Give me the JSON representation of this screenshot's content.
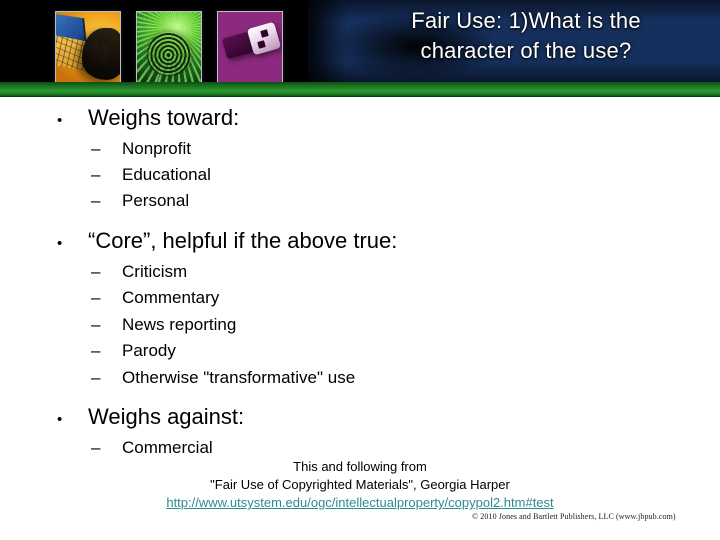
{
  "slide": {
    "title_line1": "Fair Use:  1)What is the",
    "title_line2": "character of the use?",
    "title_full": "Fair Use:  1)What is the\ncharacter of the use?"
  },
  "header": {
    "thumbnails": [
      {
        "name": "laptop-keyboard-hand-thumbnail",
        "alt": "Hand typing on a laptop keyboard"
      },
      {
        "name": "fingerprint-thumbnail",
        "alt": "Green fingerprint"
      },
      {
        "name": "usb-flash-drive-thumbnail",
        "alt": "Magenta USB flash drive"
      }
    ]
  },
  "bullets": [
    {
      "label": "Weighs toward:",
      "marker": "•",
      "children": [
        {
          "marker": "–",
          "label": "Nonprofit"
        },
        {
          "marker": "–",
          "label": "Educational"
        },
        {
          "marker": "–",
          "label": "Personal"
        }
      ]
    },
    {
      "label": "“Core”, helpful if the above true:",
      "marker": "•",
      "children": [
        {
          "marker": "–",
          "label": "Criticism"
        },
        {
          "marker": "–",
          "label": "Commentary"
        },
        {
          "marker": "–",
          "label": "News reporting"
        },
        {
          "marker": "–",
          "label": "Parody"
        },
        {
          "marker": "–",
          "label": "Otherwise \"transformative\" use"
        }
      ]
    },
    {
      "label": "Weighs against:",
      "marker": "•",
      "children": [
        {
          "marker": "–",
          "label": "Commercial"
        }
      ]
    }
  ],
  "source_note": {
    "line1": "This and following from",
    "line2": "\"Fair Use of Copyrighted Materials\", Georgia Harper",
    "url": "http://www.utsystem.edu/ogc/intellectualproperty/copypol2.htm#test"
  },
  "copyright": "© 2010 Jones and Bartlett Publishers, LLC (www.jbpub.com)",
  "colors": {
    "green_bar": "#2f9b33",
    "banner_bg": "#000000",
    "digital_blue": "#16305e",
    "url_teal": "#2e8b8f",
    "text": "#000000"
  }
}
